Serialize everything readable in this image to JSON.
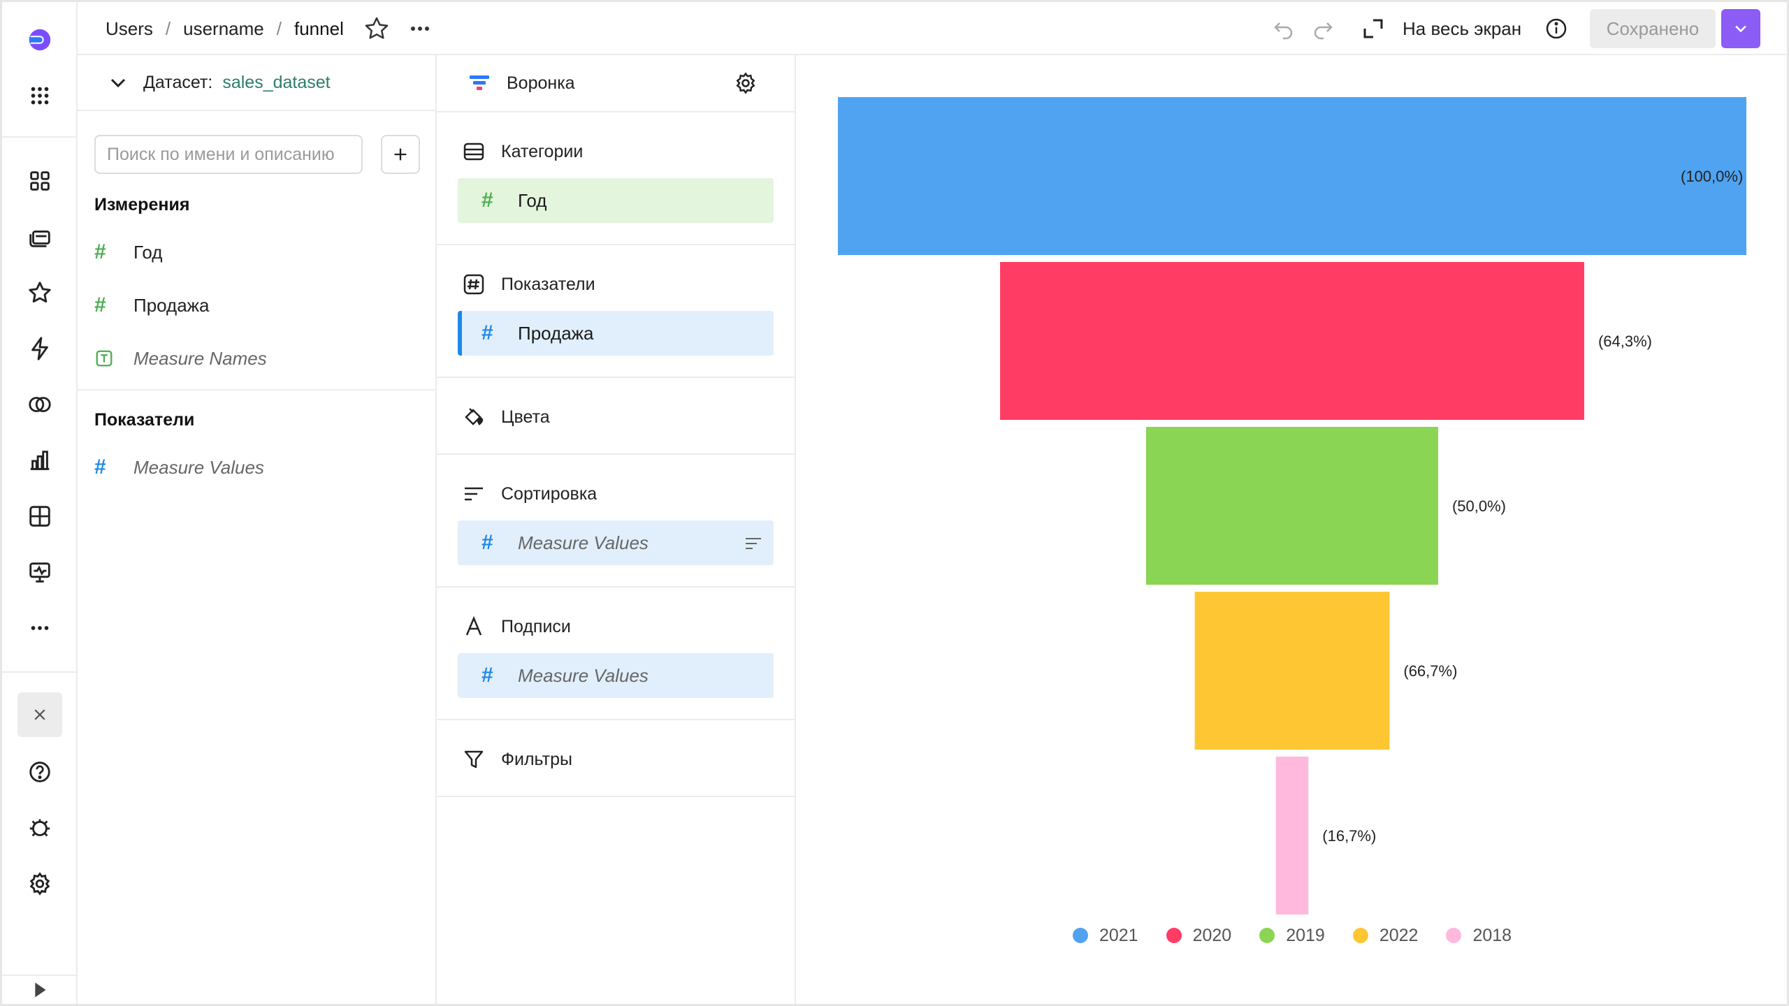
{
  "header": {
    "breadcrumbs": [
      "Users",
      "username",
      "funnel"
    ],
    "fullscreen_label": "На весь экран",
    "saved_label": "Сохранено"
  },
  "dataset": {
    "label": "Датасет:",
    "name": "sales_dataset",
    "search_placeholder": "Поиск по имени и описанию",
    "dimensions_title": "Измерения",
    "dimensions": [
      {
        "icon": "#",
        "label": "Год"
      },
      {
        "icon": "#",
        "label": "Продажа"
      },
      {
        "icon": "T",
        "label": "Measure Names"
      }
    ],
    "measures_title": "Показатели",
    "measures": [
      {
        "icon": "#",
        "label": "Measure Values"
      }
    ]
  },
  "wizard": {
    "chart_type": "Воронка",
    "sections": {
      "categories": {
        "title": "Категории",
        "items": [
          "Год"
        ]
      },
      "measures": {
        "title": "Показатели",
        "items": [
          "Продажа"
        ]
      },
      "colors": {
        "title": "Цвета"
      },
      "sort": {
        "title": "Сортировка",
        "items": [
          "Measure Values"
        ]
      },
      "labels": {
        "title": "Подписи",
        "items": [
          "Measure Values"
        ]
      },
      "filters": {
        "title": "Фильтры"
      }
    }
  },
  "chart_data": {
    "type": "funnel",
    "categories": [
      "2021",
      "2020",
      "2019",
      "2022",
      "2018"
    ],
    "values": [
      100.0,
      64.3,
      50.0,
      66.7,
      16.7
    ],
    "labels": [
      "(100,0%)",
      "(64,3%)",
      "(50,0%)",
      "(66,7%)",
      "(16,7%)"
    ],
    "colors": [
      "#4fa3f0",
      "#ff3d64",
      "#8ad554",
      "#ffc634",
      "#ffb9dd"
    ],
    "legend": [
      "2021",
      "2020",
      "2019",
      "2022",
      "2018"
    ]
  }
}
